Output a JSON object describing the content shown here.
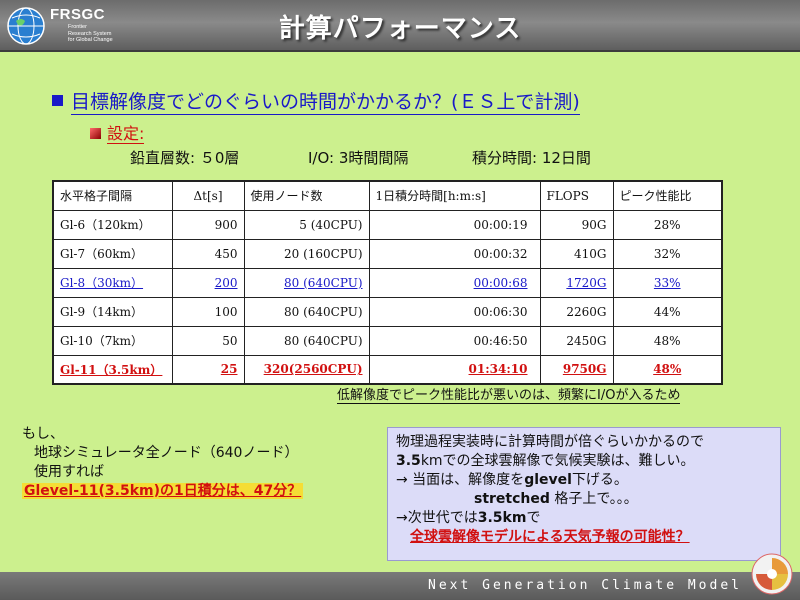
{
  "header": {
    "logo_name": "FRSGC",
    "logo_sub_1": "Frontier",
    "logo_sub_2": "Research System",
    "logo_sub_3": "for Global Change",
    "title": "計算パフォーマンス"
  },
  "headline": "目標解像度でどのぐらいの時間がかかるか？(ＥＳ上で計測)",
  "subhead": "設定:",
  "params": {
    "vertical": "鉛直層数: ５0層",
    "io": "I/O: 3時間間隔",
    "integration": "積分時間: 12日間"
  },
  "table": {
    "headers": [
      "水平格子間隔",
      "Δt[s]",
      "使用ノード数",
      "1日積分時間[h:m:s]",
      "FLOPS",
      "ピーク性能比"
    ],
    "rows": [
      [
        "Gl-6（120km）",
        "900",
        "5 (40CPU)",
        "00:00:19",
        "90G",
        "28%"
      ],
      [
        "Gl-7（60km）",
        "450",
        "20 (160CPU)",
        "00:00:32",
        "410G",
        "32%"
      ],
      [
        "Gl-8（30km）",
        "200",
        "80 (640CPU)",
        "00:00:68",
        "1720G",
        "33%"
      ],
      [
        "Gl-9（14km）",
        "100",
        "80 (640CPU)",
        "00:06:30",
        "2260G",
        "44%"
      ],
      [
        "Gl-10（7km）",
        "50",
        "80 (640CPU)",
        "00:46:50",
        "2450G",
        "48%"
      ],
      [
        "Gl-11（3.5km）",
        "25",
        "320(2560CPU)",
        "01:34:10",
        "9750G",
        "48%"
      ]
    ]
  },
  "table_note": "低解像度でピーク性能比が悪いのは、頻繁にI/Oが入るため",
  "left_note": {
    "line1": "もし、",
    "line2": "地球シミュレータ全ノード（640ノード）",
    "line3": "使用すれば",
    "line4": "Glevel-11(3.5km)の1日積分は、47分？"
  },
  "box": {
    "line1": "物理過程実装時に計算時間が倍ぐらいかかるので",
    "line2_b": "3.5",
    "line2": "kmでの全球雲解像で気候実験は、難しい。",
    "line3_pre": "→ 当面は、解像度を",
    "line3_b": "glevel",
    "line3_post": "下げる。",
    "line4_b": "stretched",
    "line4": " 格子上で。。。",
    "line5_pre": "→次世代では",
    "line5_b": "3.5km",
    "line5_post": "で",
    "line6": "全球雲解像モデルによる天気予報の可能性？"
  },
  "footer": {
    "text": "Next Generation Climate Model"
  },
  "colors": {
    "background": "#ccf08e",
    "heading_blue": "#1919c8",
    "alert_red": "#d11010",
    "box_bg": "#dcdcf8"
  }
}
